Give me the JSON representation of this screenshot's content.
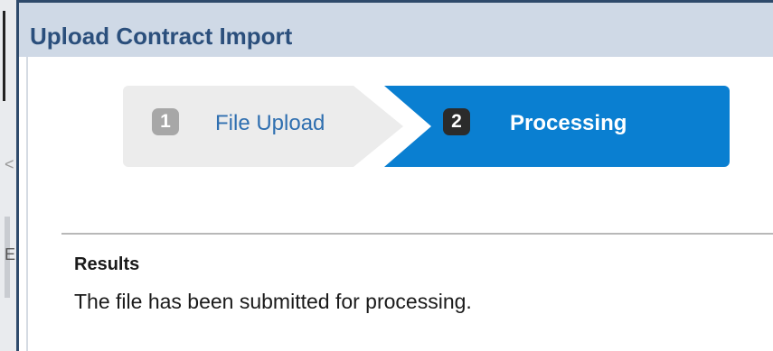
{
  "dialog": {
    "title": "Upload Contract Import"
  },
  "wizard": {
    "steps": [
      {
        "number": "1",
        "label": "File Upload",
        "state": "inactive"
      },
      {
        "number": "2",
        "label": "Processing",
        "state": "active"
      }
    ]
  },
  "results": {
    "heading": "Results",
    "message": "The file has been submitted for processing."
  },
  "background": {
    "partial_glyph": "E",
    "partial_chevron": "<"
  },
  "colors": {
    "header_bg": "#cfd9e6",
    "title_text": "#2b4f7c",
    "active_step": "#0a7fd1",
    "inactive_step": "#ececec",
    "inactive_label": "#2f6fb0"
  }
}
